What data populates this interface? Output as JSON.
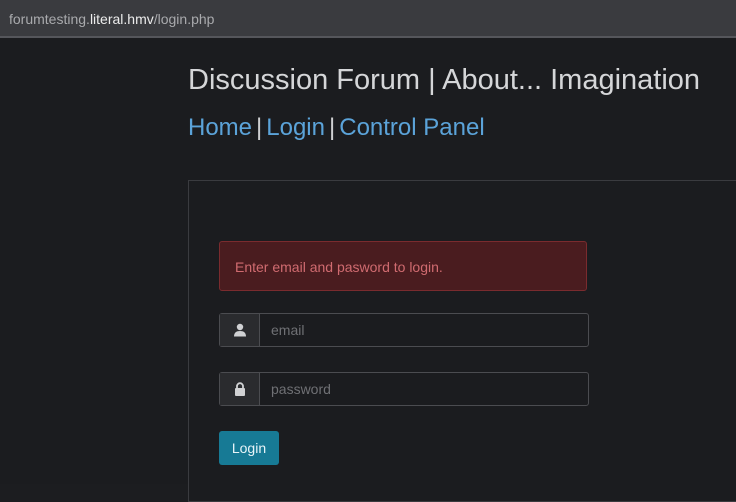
{
  "browser": {
    "url_prefix": "forumtesting.",
    "url_domain": "literal.hmv",
    "url_path": "/login.php"
  },
  "site": {
    "title": "Discussion Forum | About... Imagination"
  },
  "nav": {
    "home": "Home",
    "login": "Login",
    "control_panel": "Control Panel",
    "separator": "|"
  },
  "form": {
    "alert": "Enter email and pasword to login.",
    "email_placeholder": "email",
    "password_placeholder": "password",
    "submit_label": "Login",
    "email_icon": "user-icon",
    "password_icon": "lock-icon"
  },
  "colors": {
    "link": "#5ba3d9",
    "alert_bg": "#4a1c1f",
    "alert_text": "#d06b70",
    "button": "#177a95"
  }
}
